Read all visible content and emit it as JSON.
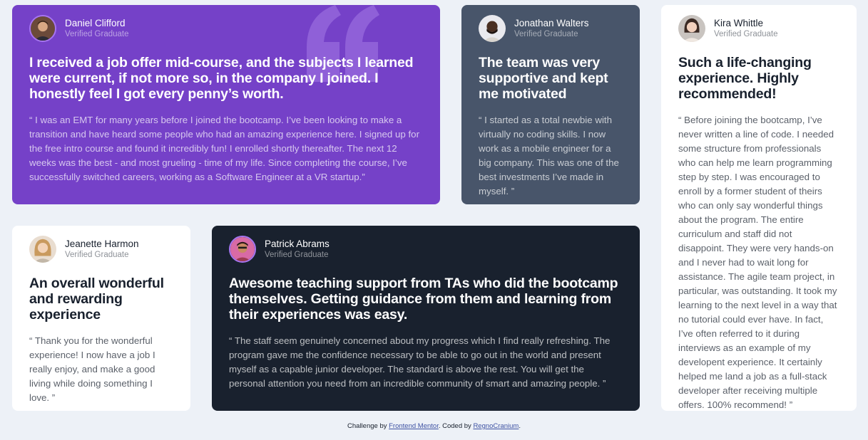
{
  "testimonials": [
    {
      "name": "Daniel Clifford",
      "role": "Verified Graduate",
      "headline": "I received a job offer mid-course, and the subjects I learned were current, if not more so, in the company I joined. I honestly feel I got every penny’s worth.",
      "body": "“ I was an EMT for many years before I joined the bootcamp. I’ve been looking to make a transition and have heard some people who had an amazing experience here. I signed up for the free intro course and found it incredibly fun! I enrolled shortly thereafter. The next 12 weeks was the best - and most grueling - time of my life. Since completing the course, I’ve successfully switched careers, working as a Software Engineer at a VR startup.”",
      "color": "#7541c8"
    },
    {
      "name": "Jonathan Walters",
      "role": "Verified Graduate",
      "headline": "The team was very supportive and kept me motivated",
      "body": "“ I started as a total newbie with virtually no coding skills. I now work as a mobile engineer for a big company. This was one of the best investments I’ve made in myself. ”",
      "color": "#48556a"
    },
    {
      "name": "Kira Whittle",
      "role": "Verified Graduate",
      "headline": "Such a life-changing experience. Highly recommended!",
      "body": "“ Before joining the bootcamp, I’ve never written a line of code. I needed some structure from professionals who can help me learn programming step by step. I was encouraged to enroll by a former student of theirs who can only say wonderful things about the program. The entire curriculum and staff did not disappoint. They were very hands-on and I never had to wait long for assistance. The agile team project, in particular, was outstanding. It took my learning to the next level in a way that no tutorial could ever have. In fact, I’ve often referred to it during interviews as an example of my developent experience. It certainly helped me land a job as a full-stack developer after receiving multiple offers. 100% recommend! ”",
      "color": "#ffffff"
    },
    {
      "name": "Jeanette Harmon",
      "role": "Verified Graduate",
      "headline": "An overall wonderful and rewarding experience",
      "body": "“ Thank you for the wonderful experience! I now have a job I really enjoy, and make a good living while doing something I love. ”",
      "color": "#ffffff"
    },
    {
      "name": "Patrick Abrams",
      "role": "Verified Graduate",
      "headline": "Awesome teaching support from TAs who did the bootcamp themselves. Getting guidance from them and learning from their experiences was easy.",
      "body": "“ The staff seem genuinely concerned about my progress which I find really refreshing. The program gave me the confidence necessary to be able to go out in the world and present myself as a capable junior developer. The standard is above the rest. You will get the personal attention you need from an incredible community of smart and amazing people. ”",
      "color": "#19212e"
    }
  ],
  "footer": {
    "prefix": "Challenge by ",
    "challenge_link": "Frontend Mentor",
    "middle": ". Coded by ",
    "coder_link": "RegnoCranium",
    "suffix": "."
  }
}
